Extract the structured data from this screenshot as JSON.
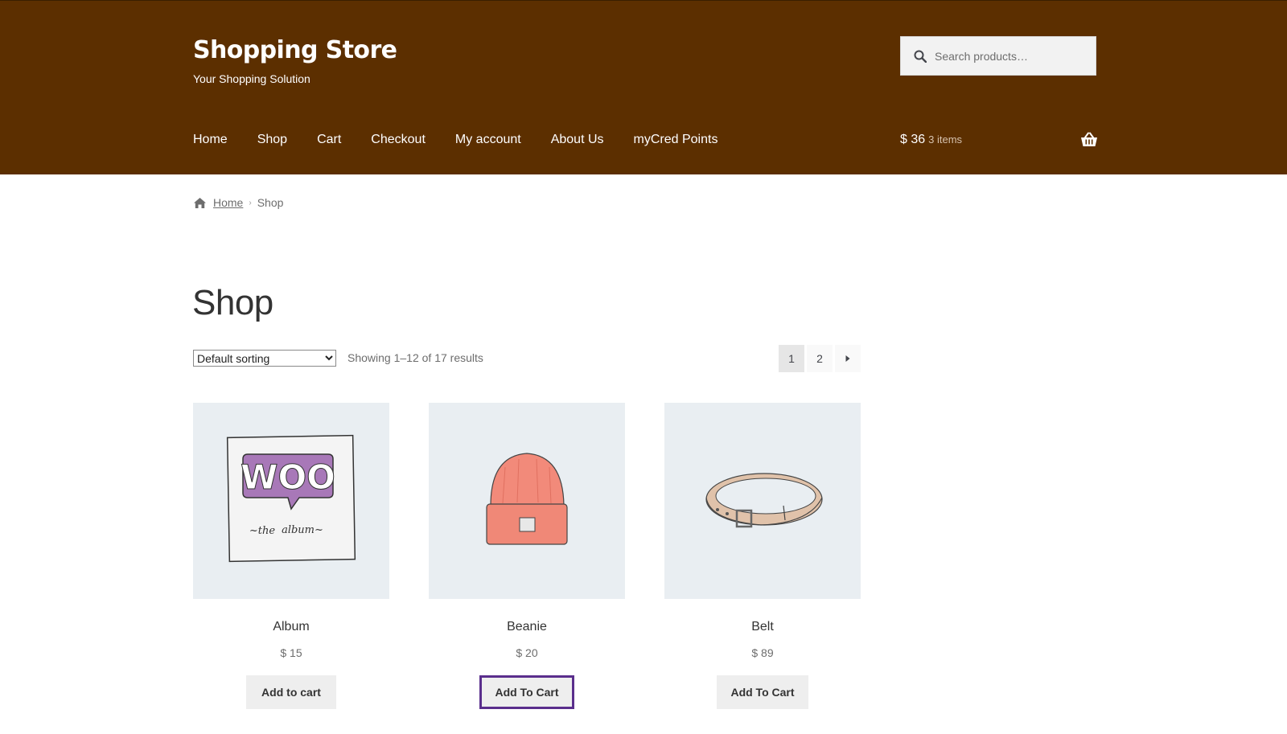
{
  "site": {
    "title": "Shopping Store",
    "tagline": "Your Shopping Solution"
  },
  "search": {
    "placeholder": "Search products…",
    "icon": "search-icon"
  },
  "nav": {
    "items": [
      {
        "label": "Home"
      },
      {
        "label": "Shop"
      },
      {
        "label": "Cart"
      },
      {
        "label": "Checkout"
      },
      {
        "label": "My account"
      },
      {
        "label": "About Us"
      },
      {
        "label": "myCred Points"
      }
    ]
  },
  "cart": {
    "total": "$ 36",
    "count": "3 items",
    "icon": "basket-icon"
  },
  "breadcrumb": {
    "home": "Home",
    "current": "Shop"
  },
  "page": {
    "title": "Shop"
  },
  "toolbar": {
    "sort_selected": "Default sorting",
    "result_count": "Showing 1–12 of 17 results"
  },
  "pagination": {
    "pages": [
      "1",
      "2"
    ],
    "current": "1",
    "next_icon": "arrow-right-icon"
  },
  "products": [
    {
      "name": "Album",
      "price": "$ 15",
      "button": "Add to cart"
    },
    {
      "name": "Beanie",
      "price": "$ 20",
      "button": "Add To Cart"
    },
    {
      "name": "Belt",
      "price": "$ 89",
      "button": "Add To Cart"
    }
  ],
  "colors": {
    "header_bg": "#5c2f00",
    "focus_outline": "#5a2e8c",
    "product_bg": "#e9eef2"
  }
}
